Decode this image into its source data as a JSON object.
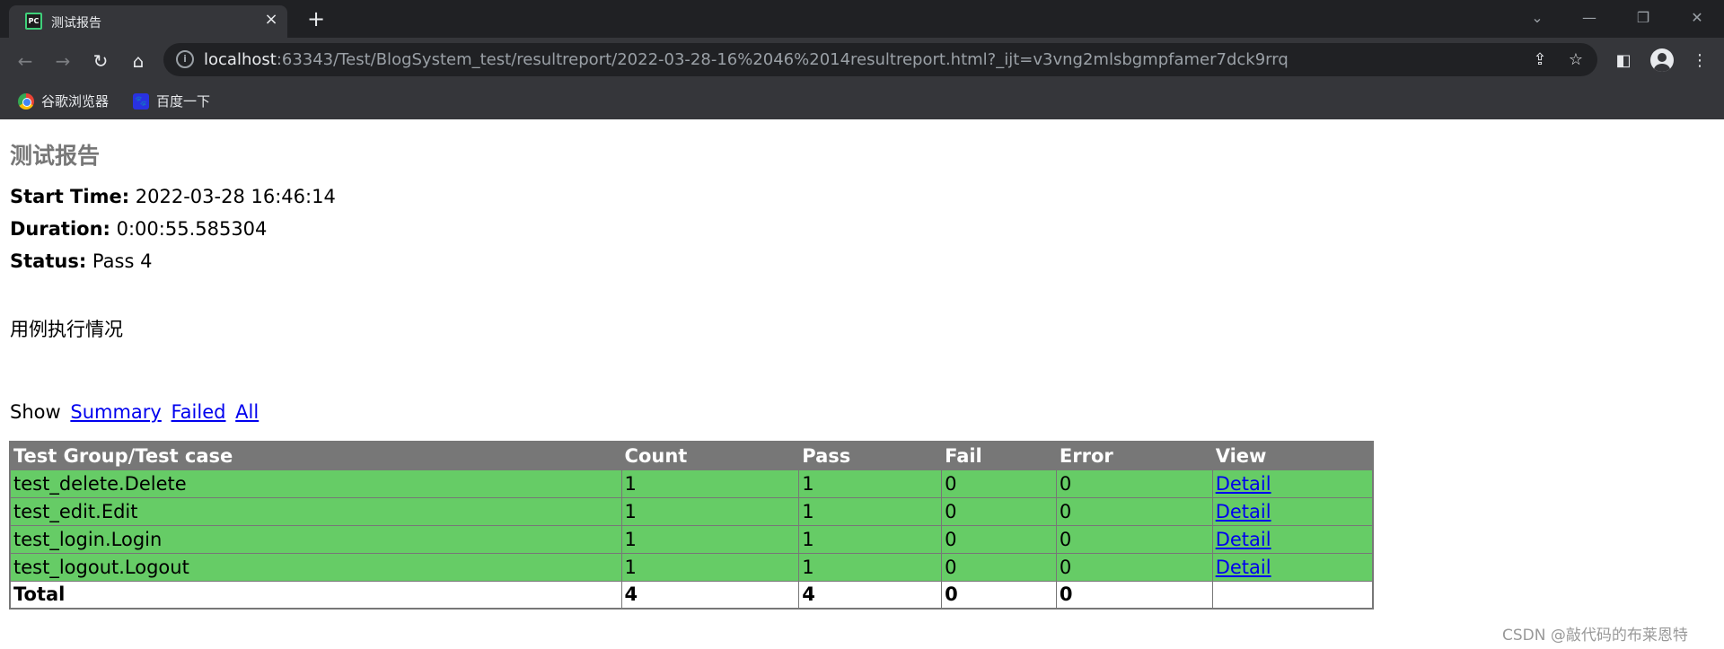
{
  "browser": {
    "tab_title": "测试报告",
    "tab_favicon_text": "PC",
    "new_tab_glyph": "+",
    "close_glyph": "×",
    "url_host": "localhost",
    "url_rest": ":63343/Test/BlogSystem_test/resultreport/2022-03-28-16%2046%2014resultreport.html?_ijt=v3vng2mlsbgmpfamer7dck9rrq",
    "bookmarks": [
      {
        "label": "谷歌浏览器",
        "icon": "chrome-icon"
      },
      {
        "label": "百度一下",
        "icon": "baidu-icon"
      }
    ]
  },
  "report": {
    "title": "测试报告",
    "start_time_label": "Start Time:",
    "start_time_value": "2022-03-28 16:46:14",
    "duration_label": "Duration:",
    "duration_value": "0:00:55.585304",
    "status_label": "Status:",
    "status_value": "Pass 4",
    "section_text": "用例执行情况",
    "show_label": "Show",
    "filters": [
      "Summary",
      "Failed",
      "All"
    ],
    "table": {
      "headers": [
        "Test Group/Test case",
        "Count",
        "Pass",
        "Fail",
        "Error",
        "View"
      ],
      "rows": [
        {
          "name": "test_delete.Delete",
          "count": "1",
          "pass": "1",
          "fail": "0",
          "error": "0",
          "view": "Detail"
        },
        {
          "name": "test_edit.Edit",
          "count": "1",
          "pass": "1",
          "fail": "0",
          "error": "0",
          "view": "Detail"
        },
        {
          "name": "test_login.Login",
          "count": "1",
          "pass": "1",
          "fail": "0",
          "error": "0",
          "view": "Detail"
        },
        {
          "name": "test_logout.Logout",
          "count": "1",
          "pass": "1",
          "fail": "0",
          "error": "0",
          "view": "Detail"
        }
      ],
      "total": {
        "name": "Total",
        "count": "4",
        "pass": "4",
        "fail": "0",
        "error": "0",
        "view": ""
      }
    },
    "colors": {
      "header_bg": "#777777",
      "pass_row_bg": "#66cc66",
      "link": "#0000ee"
    }
  },
  "watermark": "CSDN @敲代码的布莱恩特"
}
